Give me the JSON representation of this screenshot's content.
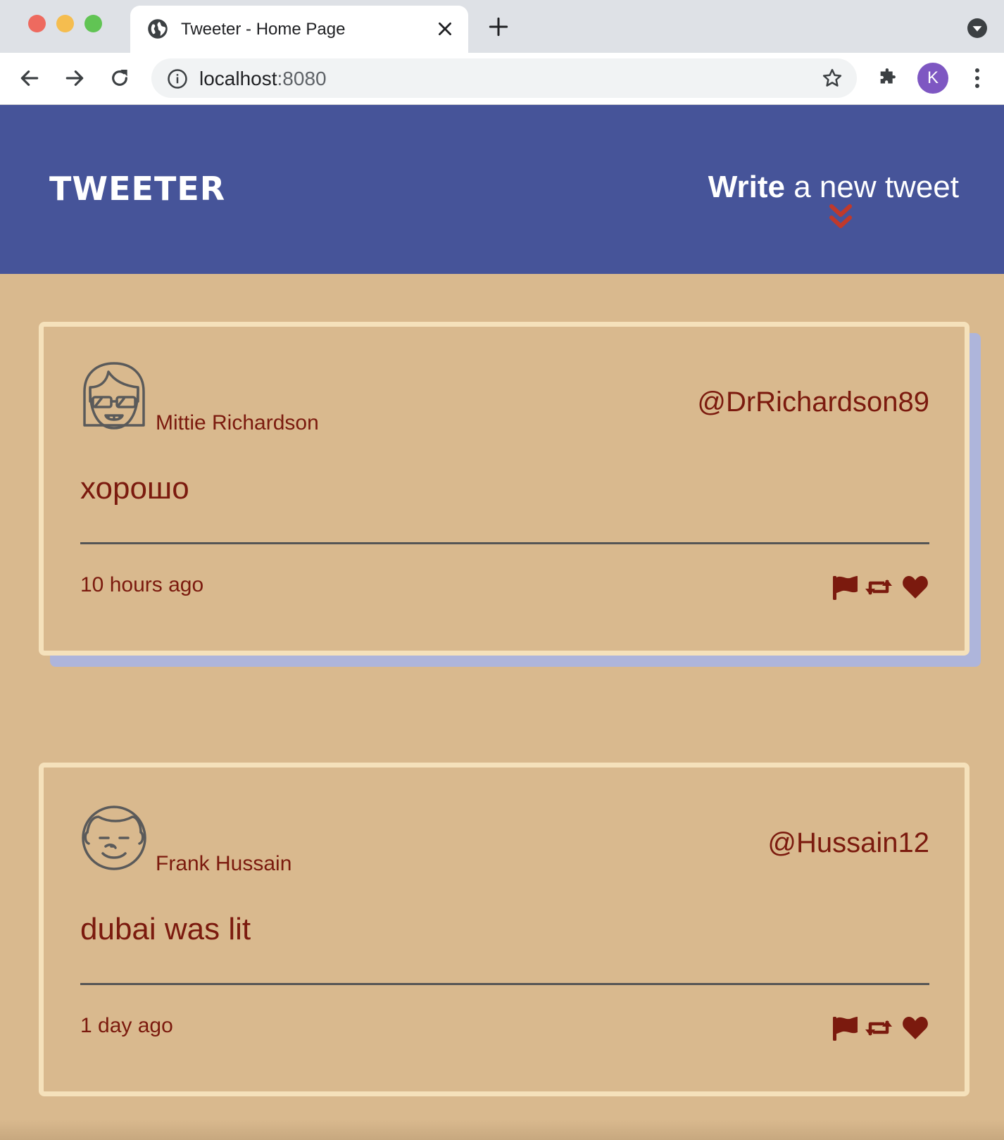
{
  "browser": {
    "tab_title": "Tweeter - Home Page",
    "url_host": "localhost",
    "url_port": ":8080",
    "profile_initial": "K",
    "profile_color": "#7e57c2"
  },
  "header": {
    "logo": "TWEETER",
    "compose_bold": "Write",
    "compose_rest": " a new tweet",
    "background": "#465499"
  },
  "tweets": [
    {
      "name": "Mittie Richardson",
      "handle": "@DrRichardson89",
      "text": "хорошо",
      "time": "10 hours ago",
      "avatar_icon": "avatar-sunglasses-icon"
    },
    {
      "name": "Frank Hussain",
      "handle": "@Hussain12",
      "text": "dubai was lit",
      "time": "1 day ago",
      "avatar_icon": "avatar-smiling-icon"
    }
  ],
  "colors": {
    "page_bg": "#d9b98e",
    "tweet_text": "#7b1a0e",
    "card_border": "#f5e1bb",
    "card_shadow": "#aeb5db",
    "compose_arrow": "#c0392b"
  }
}
